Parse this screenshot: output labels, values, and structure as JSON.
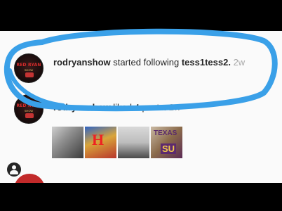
{
  "notifications": [
    {
      "user": "rodryanshow",
      "action": "started following",
      "target": "tess1tess2.",
      "time": "2w",
      "avatar_icon": "red-ryan-show-logo"
    },
    {
      "user": "rodryanshow",
      "action": "liked 4 posts.",
      "time": "2w",
      "avatar_icon": "red-ryan-show-logo",
      "thumbnails": [
        "post-thumbnail-1",
        "post-thumbnail-2",
        "post-thumbnail-3",
        "post-thumbnail-4"
      ]
    }
  ],
  "avatar_logo": {
    "title": "RED RYAN",
    "subtitle": "SHOW"
  },
  "thumbnail_text": {
    "t2": "H",
    "t4_top": "TEXAS",
    "t4_bottom": "SU"
  },
  "colors": {
    "highlight": "#3aa0e8",
    "username": "#262626",
    "timestamp": "#a8a8a8",
    "brand_red": "#d62b2b"
  }
}
